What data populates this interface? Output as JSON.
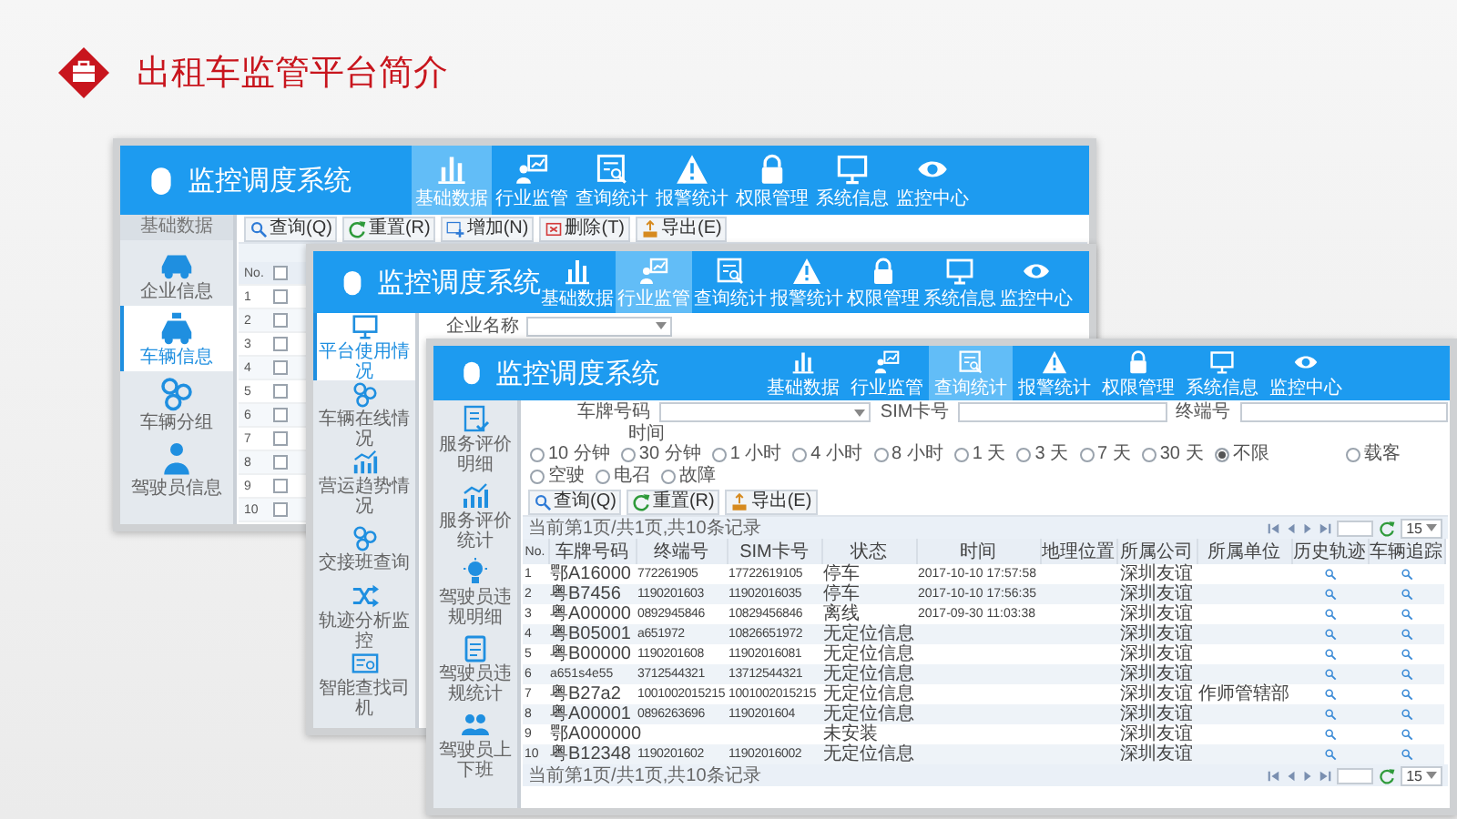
{
  "slide_title": "出租车监管平台简介",
  "windows": [
    {
      "title": "监控调度系统",
      "nav": [
        {
          "label": "基础数据",
          "kind": "bars",
          "selected": true
        },
        {
          "label": "行业监管",
          "kind": "board",
          "selected": false
        },
        {
          "label": "查询统计",
          "kind": "report",
          "selected": false
        },
        {
          "label": "报警统计",
          "kind": "warn",
          "selected": false
        },
        {
          "label": "权限管理",
          "kind": "lock",
          "selected": false
        },
        {
          "label": "系统信息",
          "kind": "monitor",
          "selected": false
        },
        {
          "label": "监控中心",
          "kind": "eye",
          "selected": false
        }
      ],
      "sidebar": {
        "heading": "基础数据",
        "items": [
          {
            "label": "企业信息",
            "kind": "car",
            "selected": false
          },
          {
            "label": "车辆信息",
            "kind": "taxi",
            "selected": true
          },
          {
            "label": "车辆分组",
            "kind": "group",
            "selected": false
          },
          {
            "label": "驾驶员信息",
            "kind": "driver",
            "selected": false
          }
        ]
      },
      "toolbar": [
        {
          "label": "查询(Q)",
          "kind": "search"
        },
        {
          "label": "重置(R)",
          "kind": "refresh"
        },
        {
          "label": "增加(N)",
          "kind": "plus"
        },
        {
          "label": "删除(T)",
          "kind": "delete"
        },
        {
          "label": "导出(E)",
          "kind": "export"
        }
      ],
      "table": {
        "kind": "checklist",
        "number_heading": "No.",
        "select_all_checked": false,
        "rows": [
          {
            "number": "1",
            "checked": false
          },
          {
            "number": "2",
            "checked": false
          },
          {
            "number": "3",
            "checked": false
          },
          {
            "number": "4",
            "checked": false
          },
          {
            "number": "5",
            "checked": false
          },
          {
            "number": "6",
            "checked": false
          },
          {
            "number": "7",
            "checked": false
          },
          {
            "number": "8",
            "checked": false
          },
          {
            "number": "9",
            "checked": false
          },
          {
            "number": "10",
            "checked": false
          }
        ]
      }
    },
    {
      "title": "监控调度系统",
      "nav": [
        {
          "label": "基础数据",
          "kind": "bars",
          "selected": false
        },
        {
          "label": "行业监管",
          "kind": "board",
          "selected": true
        },
        {
          "label": "查询统计",
          "kind": "report",
          "selected": false
        },
        {
          "label": "报警统计",
          "kind": "warn",
          "selected": false
        },
        {
          "label": "权限管理",
          "kind": "lock",
          "selected": false
        },
        {
          "label": "系统信息",
          "kind": "monitor",
          "selected": false
        },
        {
          "label": "监控中心",
          "kind": "eye",
          "selected": false
        }
      ],
      "sidebar": {
        "items": [
          {
            "label": "平台使用情况",
            "kind": "monitor",
            "selected": true
          },
          {
            "label": "车辆在线情况",
            "kind": "group",
            "selected": false
          },
          {
            "label": "营运趋势情况",
            "kind": "trend",
            "selected": false
          },
          {
            "label": "交接班查询",
            "kind": "group",
            "selected": false
          },
          {
            "label": "轨迹分析监控",
            "kind": "shuffle",
            "selected": false
          },
          {
            "label": "智能查找司机",
            "kind": "idcard",
            "selected": false
          }
        ]
      },
      "company_filter": {
        "label": "企业名称"
      }
    },
    {
      "title": "监控调度系统",
      "nav": [
        {
          "label": "基础数据",
          "kind": "bars",
          "selected": false
        },
        {
          "label": "行业监管",
          "kind": "board",
          "selected": false
        },
        {
          "label": "查询统计",
          "kind": "report",
          "selected": true
        },
        {
          "label": "报警统计",
          "kind": "warn",
          "selected": false
        },
        {
          "label": "权限管理",
          "kind": "lock",
          "selected": false
        },
        {
          "label": "系统信息",
          "kind": "monitor",
          "selected": false
        },
        {
          "label": "监控中心",
          "kind": "eye",
          "selected": false
        }
      ],
      "sidebar": {
        "items": [
          {
            "label": "服务评价明细",
            "kind": "doccheck",
            "selected": false
          },
          {
            "label": "服务评价统计",
            "kind": "trend",
            "selected": false
          },
          {
            "label": "驾驶员违规明细",
            "kind": "bulb",
            "selected": false
          },
          {
            "label": "驾驶员违规统计",
            "kind": "note",
            "selected": false
          },
          {
            "label": "驾驶员上下班",
            "kind": "people",
            "selected": false
          }
        ]
      },
      "filters": {
        "fields": [
          {
            "label": "车牌号码",
            "kind": "select"
          },
          {
            "label": "SIM卡号",
            "kind": "input"
          },
          {
            "label": "终端号",
            "kind": "input"
          }
        ],
        "time_label": "时间",
        "time_options": [
          {
            "label": "10 分钟",
            "selected": false
          },
          {
            "label": "30 分钟",
            "selected": false
          },
          {
            "label": "1 小时",
            "selected": false
          },
          {
            "label": "4 小时",
            "selected": false
          },
          {
            "label": "8 小时",
            "selected": false
          },
          {
            "label": "1 天",
            "selected": false
          },
          {
            "label": "3 天",
            "selected": false
          },
          {
            "label": "7 天",
            "selected": false
          },
          {
            "label": "30 天",
            "selected": false
          },
          {
            "label": "不限",
            "selected": true
          }
        ],
        "status_options": [
          {
            "label": "载客",
            "selected": false
          },
          {
            "label": "空驶",
            "selected": false
          },
          {
            "label": "电召",
            "selected": false
          },
          {
            "label": "故障",
            "selected": false
          }
        ]
      },
      "toolbar": [
        {
          "label": "查询(Q)",
          "kind": "search"
        },
        {
          "label": "重置(R)",
          "kind": "refresh"
        },
        {
          "label": "导出(E)",
          "kind": "export"
        }
      ],
      "record_info": "当前第1页/共1页,共10条记录",
      "page_size": "15",
      "table": {
        "kind": "records",
        "columns": [
          "No.",
          "车牌号码",
          "终端号",
          "SIM卡号",
          "状态",
          "时间",
          "地理位置",
          "所属公司",
          "所属单位",
          "历史轨迹",
          "车辆追踪"
        ],
        "rows": [
          {
            "number": "1",
            "plate": "鄂A16000",
            "terminal": "772261905",
            "sim": "17722619105",
            "status": "停车",
            "time": "2017-10-10 17:57:58",
            "company": "深圳友谊"
          },
          {
            "number": "2",
            "plate": "粤B7456",
            "terminal": "1190201603",
            "sim": "11902016035",
            "status": "停车",
            "time": "2017-10-10 17:56:35",
            "company": "深圳友谊"
          },
          {
            "number": "3",
            "plate": "粤A00000",
            "terminal": "0892945846",
            "sim": "10829456846",
            "status": "离线",
            "time": "2017-09-30 11:03:38",
            "company": "深圳友谊"
          },
          {
            "number": "4",
            "plate": "粤B05001",
            "terminal": "a651972",
            "sim": "10826651972",
            "status": "无定位信息",
            "company": "深圳友谊"
          },
          {
            "number": "5",
            "plate": "粤B00000",
            "terminal": "1190201608",
            "sim": "11902016081",
            "status": "无定位信息",
            "company": "深圳友谊"
          },
          {
            "number": "6",
            "plate": "a651s4e55",
            "terminal": "3712544321",
            "sim": "13712544321",
            "status": "无定位信息",
            "company": "深圳友谊"
          },
          {
            "number": "7",
            "plate": "粤B27a2",
            "terminal": "1001002015215",
            "sim": "1001002015215",
            "status": "无定位信息",
            "company": "深圳友谊",
            "unit": "作师管辖部"
          },
          {
            "number": "8",
            "plate": "粤A00001",
            "terminal": "0896263696",
            "sim": "1190201604",
            "status": "无定位信息",
            "company": "深圳友谊"
          },
          {
            "number": "9",
            "plate": "鄂A000000",
            "status": "未安装",
            "company": "深圳友谊"
          },
          {
            "number": "10",
            "plate": "粤B12348",
            "terminal": "1190201602",
            "sim": "11902016002",
            "status": "无定位信息",
            "company": "深圳友谊"
          }
        ]
      },
      "footer_info": "当前第1页/共1页,共10条记录",
      "footer_page_size": "15"
    }
  ]
}
